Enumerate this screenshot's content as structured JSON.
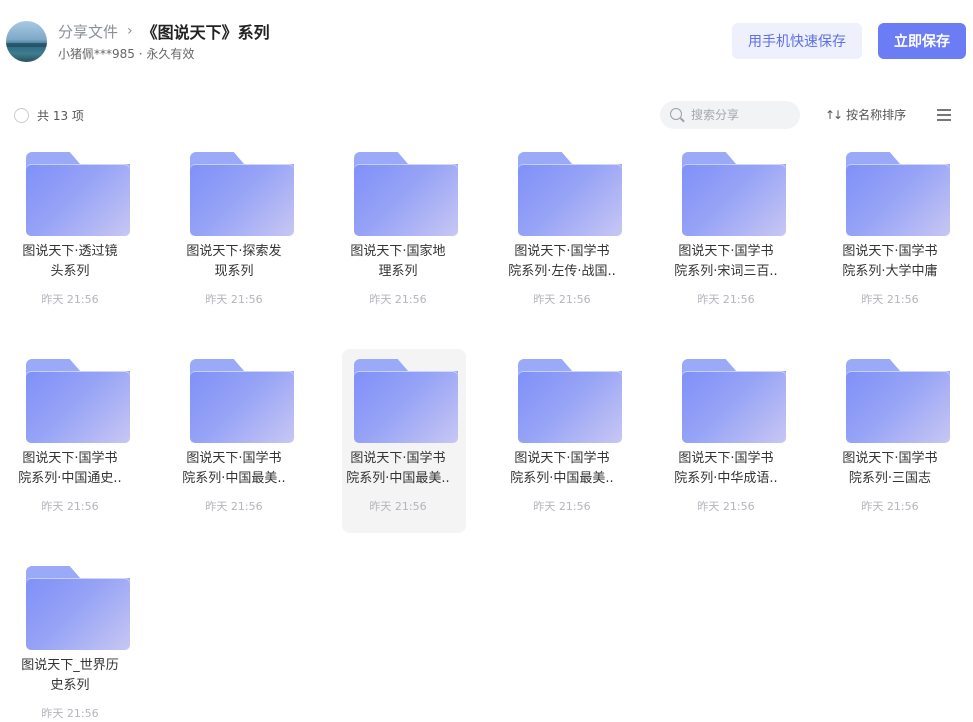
{
  "header": {
    "breadcrumb_root": "分享文件",
    "breadcrumb_sep": "›",
    "breadcrumb_current": "《图说天下》系列",
    "sharer": "小猪佩***985 · 永久有效",
    "mobile_save_label": "用手机快速保存",
    "save_label": "立即保存"
  },
  "toolbar": {
    "count_label": "共 13 项",
    "search_placeholder": "搜索分享",
    "sort_label": "按名称排序",
    "sort_icon": "↑↓"
  },
  "items": [
    {
      "name": "图说天下·透过镜头系列",
      "time": "昨天 21:56"
    },
    {
      "name": "图说天下·探索发现系列",
      "time": "昨天 21:56"
    },
    {
      "name": "图说天下·国家地理系列",
      "time": "昨天 21:56"
    },
    {
      "name": "图说天下·国学书院系列·左传·战国..",
      "time": "昨天 21:56"
    },
    {
      "name": "图说天下·国学书院系列·宋词三百..",
      "time": "昨天 21:56"
    },
    {
      "name": "图说天下·国学书院系列·大学中庸",
      "time": "昨天 21:56"
    },
    {
      "name": "图说天下·国学书院系列·中国通史..",
      "time": "昨天 21:56"
    },
    {
      "name": "图说天下·国学书院系列·中国最美..",
      "time": "昨天 21:56"
    },
    {
      "name": "图说天下·国学书院系列·中国最美..",
      "time": "昨天 21:56"
    },
    {
      "name": "图说天下·国学书院系列·中国最美..",
      "time": "昨天 21:56"
    },
    {
      "name": "图说天下·国学书院系列·中华成语..",
      "time": "昨天 21:56"
    },
    {
      "name": "图说天下·国学书院系列·三国志",
      "time": "昨天 21:56"
    },
    {
      "name": "图说天下_世界历史系列",
      "time": "昨天 21:56"
    }
  ]
}
